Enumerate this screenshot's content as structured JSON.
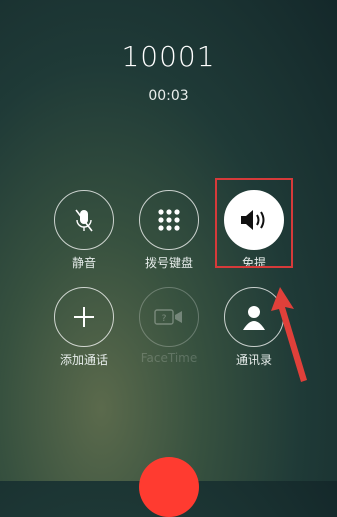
{
  "call": {
    "number": "10001",
    "timer": "00:03"
  },
  "controls": {
    "mute": {
      "label": "静音",
      "icon": "mic-off-icon"
    },
    "keypad": {
      "label": "拨号键盘",
      "icon": "keypad-icon"
    },
    "speaker": {
      "label": "免提",
      "icon": "speaker-icon",
      "state": "active"
    },
    "add_call": {
      "label": "添加通话",
      "icon": "plus-icon"
    },
    "facetime": {
      "label": "FaceTime",
      "icon": "facetime-icon",
      "state": "disabled"
    },
    "contacts": {
      "label": "通讯录",
      "icon": "contact-icon"
    }
  },
  "end_call": {
    "icon": "end-call-icon",
    "color": "#ff3b30"
  },
  "annotation": {
    "highlight_color": "#d63a3a"
  }
}
